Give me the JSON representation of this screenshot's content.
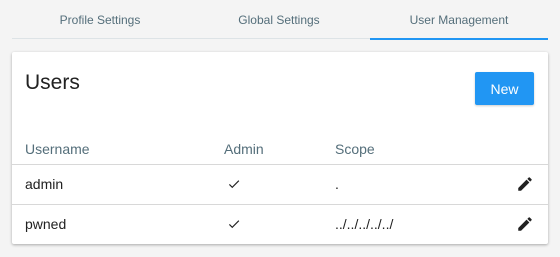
{
  "tabs": [
    {
      "label": "Profile Settings"
    },
    {
      "label": "Global Settings"
    },
    {
      "label": "User Management",
      "active": true
    }
  ],
  "colors": {
    "accent": "#2196f3",
    "tab_text": "#546e7a",
    "background": "#f4f4f4"
  },
  "users_card": {
    "title": "Users",
    "new_button_label": "New",
    "columns": {
      "username": "Username",
      "admin": "Admin",
      "scope": "Scope"
    },
    "rows": [
      {
        "username": "admin",
        "admin": true,
        "scope": "."
      },
      {
        "username": "pwned",
        "admin": true,
        "scope": "../../../../../"
      }
    ]
  },
  "icons": {
    "admin_check": "check-icon",
    "row_edit": "pencil-edit-icon"
  }
}
